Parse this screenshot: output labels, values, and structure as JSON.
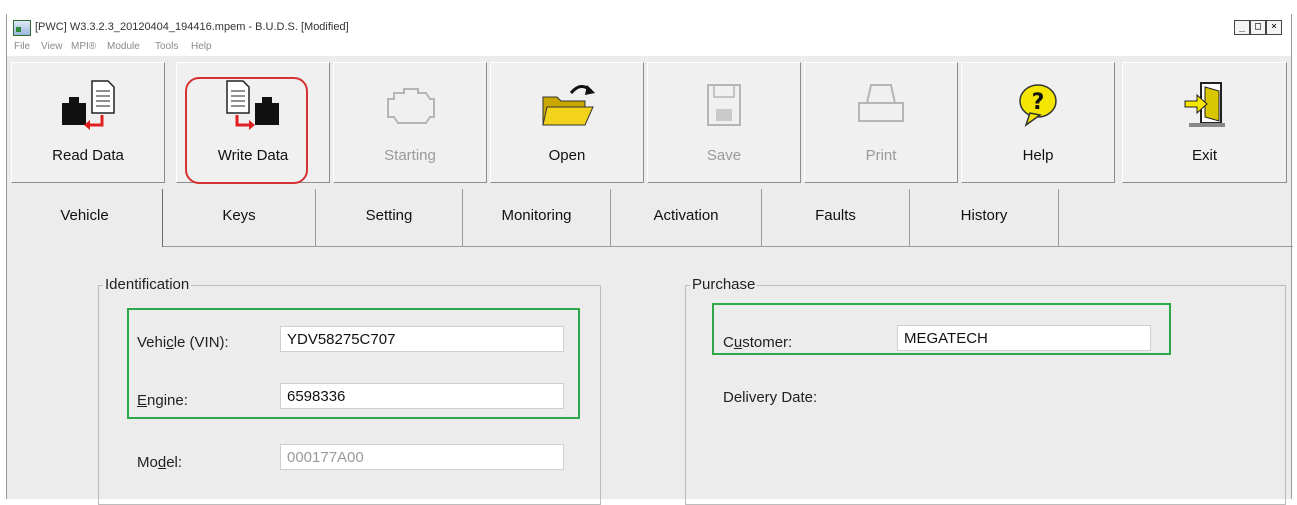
{
  "window": {
    "title": "[PWC] W3.3.2.3_20120404_194416.mpem - B.U.D.S. [Modified]",
    "controls": [
      "_",
      "□",
      "×"
    ]
  },
  "menu": {
    "items": [
      "File",
      "View",
      "MPI®",
      "Module",
      "Tools",
      "Help"
    ]
  },
  "toolbar": {
    "buttons": [
      {
        "label": "Read Data",
        "icon": "read-data-icon",
        "enabled": true
      },
      {
        "label": "Write Data",
        "icon": "write-data-icon",
        "enabled": true
      },
      {
        "label": "Starting",
        "icon": "engine-icon",
        "enabled": false
      },
      {
        "label": "Open",
        "icon": "open-folder-icon",
        "enabled": true
      },
      {
        "label": "Save",
        "icon": "floppy-disk-icon",
        "enabled": false
      },
      {
        "label": "Print",
        "icon": "printer-icon",
        "enabled": false
      },
      {
        "label": "Help",
        "icon": "help-bubble-icon",
        "enabled": true
      },
      {
        "label": "Exit",
        "icon": "exit-door-icon",
        "enabled": true
      }
    ]
  },
  "tabs": {
    "items": [
      "Vehicle",
      "Keys",
      "Setting",
      "Monitoring",
      "Activation",
      "Faults",
      "History"
    ],
    "active": "Vehicle"
  },
  "identification": {
    "title": "Identification",
    "vin_label_pre": "Vehi",
    "vin_label_u": "c",
    "vin_label_post": "le (VIN):",
    "vin_value": "YDV58275C707",
    "engine_label_u": "E",
    "engine_label_post": "ngine:",
    "engine_value": "6598336",
    "model_label_pre": "Mo",
    "model_label_u": "d",
    "model_label_post": "el:",
    "model_value": "000177A00"
  },
  "purchase": {
    "title": "Purchase",
    "customer_label_pre": "C",
    "customer_label_u": "u",
    "customer_label_post": "stomer:",
    "customer_value": "MEGATECH",
    "delivery_label": "Delivery Date:"
  },
  "colors": {
    "highlight_red": "#d63232",
    "highlight_green": "#2ea84a",
    "background": "#ececec"
  }
}
